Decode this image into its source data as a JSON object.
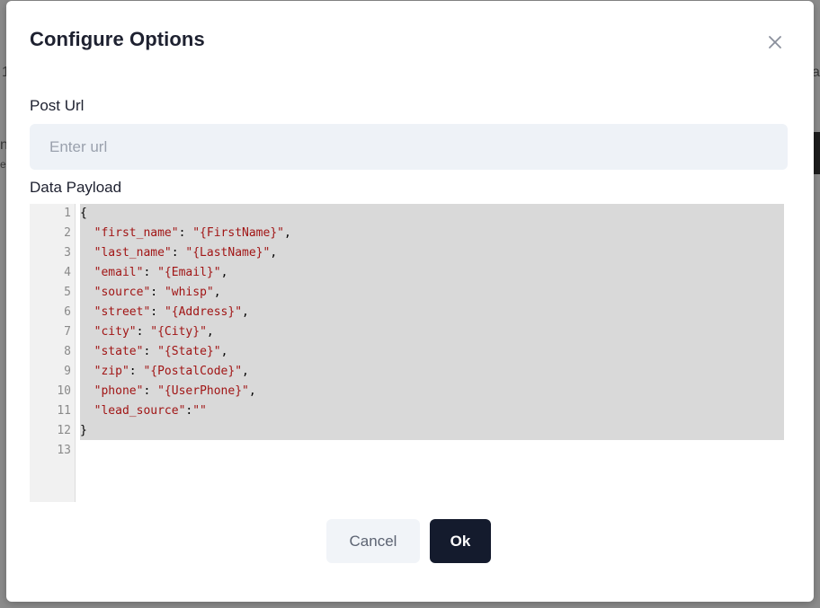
{
  "background": {
    "fragments": [
      "1",
      "n",
      "e",
      "al",
      "g"
    ]
  },
  "modal": {
    "title": "Configure Options",
    "close_icon": "close-icon"
  },
  "post_url": {
    "label": "Post Url",
    "value": "",
    "placeholder": "Enter url"
  },
  "payload": {
    "label": "Data Payload",
    "line_numbers": [
      "1",
      "2",
      "3",
      "4",
      "5",
      "6",
      "7",
      "8",
      "9",
      "10",
      "11",
      "12",
      "13"
    ],
    "lines": [
      "{",
      "  \"first_name\": \"{FirstName}\",",
      "  \"last_name\": \"{LastName}\",",
      "  \"email\": \"{Email}\",",
      "  \"source\": \"whisp\",",
      "  \"street\": \"{Address}\",",
      "  \"city\": \"{City}\",",
      "  \"state\": \"{State}\",",
      "  \"zip\": \"{PostalCode}\",",
      "  \"phone\": \"{UserPhone}\",",
      "  \"lead_source\":\"\"",
      "}",
      ""
    ]
  },
  "buttons": {
    "cancel": "Cancel",
    "ok": "Ok"
  },
  "colors": {
    "primary": "#141b2d",
    "input_bg": "#eef2f7",
    "string_token": "#a11515"
  }
}
